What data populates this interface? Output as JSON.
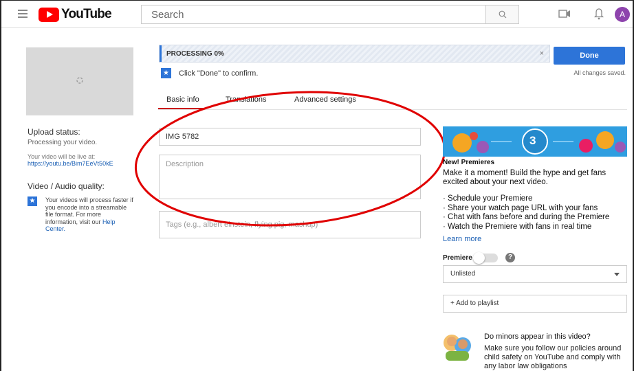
{
  "header": {
    "logo_text": "YouTube",
    "search_placeholder": "Search",
    "avatar_letter": "A"
  },
  "left": {
    "upload_status_title": "Upload status:",
    "processing_text": "Processing your video.",
    "live_at_text": "Your video will be live at:",
    "live_link": "https://youtu.be/Bim7EeVt50kE",
    "quality_title": "Video / Audio quality:",
    "quality_text": "Your videos will process faster if you encode into a streamable file format. For more information, visit our",
    "help_center_link": "Help Center."
  },
  "processing": {
    "label": "PROCESSING 0%",
    "progress_fraction": 0,
    "close_symbol": "×",
    "confirm_text": "Click \"Done\" to confirm.",
    "done_button": "Done",
    "saved_text": "All changes saved."
  },
  "tabs": [
    {
      "label": "Basic info",
      "active": true
    },
    {
      "label": "Translations",
      "active": false
    },
    {
      "label": "Advanced settings",
      "active": false
    }
  ],
  "form": {
    "title_value": "IMG 5782",
    "description_placeholder": "Description",
    "tags_placeholder": "Tags (e.g., albert einstein, flying pig, mashup)"
  },
  "premiere": {
    "banner_number": "3",
    "heading": "New! Premieres",
    "body": "Make it a moment! Build the hype and get fans excited about your next video.",
    "list": [
      "Schedule your Premiere",
      "Share your watch page URL with your fans",
      "Chat with fans before and during the Premiere",
      "Watch the Premiere with fans in real time"
    ],
    "learn_more": "Learn more",
    "toggle_label": "Premiere",
    "toggle_on": false,
    "help_symbol": "?"
  },
  "privacy": {
    "selected": "Unlisted"
  },
  "playlist": {
    "button_label": "+ Add to playlist"
  },
  "minors": {
    "title": "Do minors appear in this video?",
    "body": "Make sure you follow our policies around child safety on YouTube and comply with any labor law obligations"
  },
  "colors": {
    "brand_red": "#ff0000",
    "accent_blue": "#2d74d8",
    "annotation_red": "#e00000"
  },
  "icons": [
    "menu-icon",
    "youtube-logo-icon",
    "search-icon",
    "video-camera-icon",
    "bell-icon",
    "spinner-icon",
    "star-icon",
    "close-icon",
    "help-icon",
    "chevron-down-icon",
    "minors-icon"
  ]
}
